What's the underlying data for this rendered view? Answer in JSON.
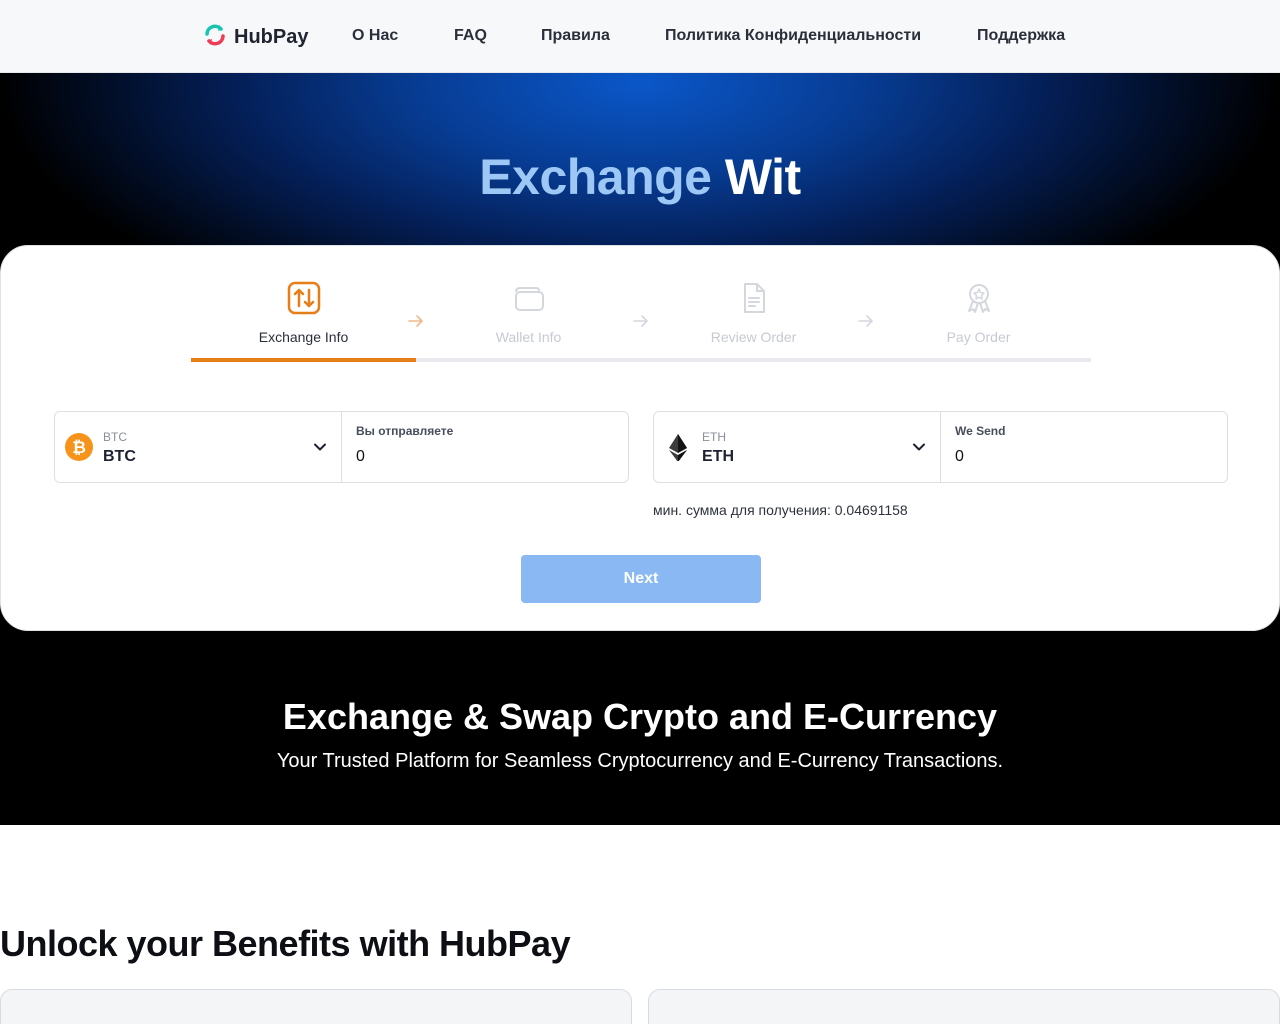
{
  "nav": {
    "logo_text": "HubPay",
    "links": [
      "О Нас",
      "FAQ",
      "Правила",
      "Политика Конфиденциальности",
      "Поддержка"
    ]
  },
  "hero": {
    "title_part1": "Exchange",
    "title_part2": "Wit"
  },
  "steps": [
    {
      "label": "Exchange Info",
      "icon": "exchange-arrows-icon",
      "active": true
    },
    {
      "label": "Wallet Info",
      "icon": "wallet-icon",
      "active": false
    },
    {
      "label": "Review Order",
      "icon": "document-icon",
      "active": false
    },
    {
      "label": "Pay Order",
      "icon": "badge-icon",
      "active": false
    }
  ],
  "send": {
    "currency_small": "BTC",
    "currency_big": "BTC",
    "amount_label": "Вы отправляете",
    "amount_value": "0"
  },
  "receive": {
    "currency_small": "ETH",
    "currency_big": "ETH",
    "amount_label": "We Send",
    "amount_value": "0"
  },
  "min_note": "мин. сумма для получения: 0.04691158",
  "next_label": "Next",
  "section": {
    "title": "Exchange & Swap Crypto and E-Currency",
    "subtitle": "Your Trusted Platform for Seamless Cryptocurrency and E-Currency Transactions."
  },
  "benefits_title": "Unlock your Benefits with HubPay",
  "colors": {
    "accent_orange": "#e77d16",
    "button_blue": "#8ab8f3",
    "hero_blue": "#0a57c9"
  }
}
